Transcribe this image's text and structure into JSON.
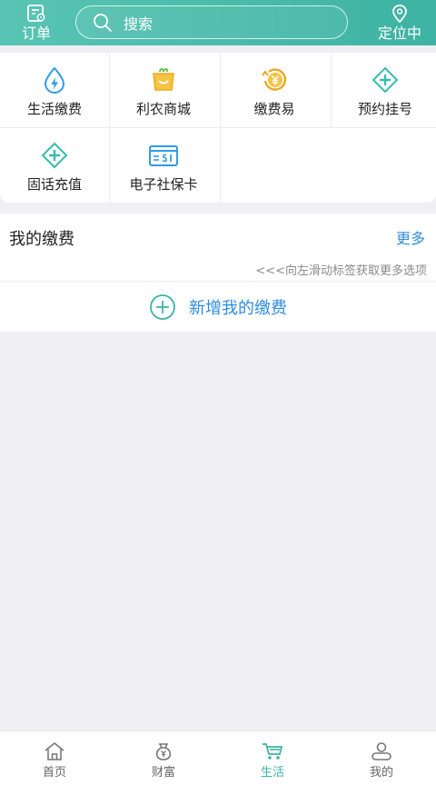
{
  "header": {
    "orders_label": "订单",
    "search_placeholder": "搜索",
    "location_label": "定位中"
  },
  "services": [
    {
      "label": "生活缴费",
      "icon": "water-bolt-icon",
      "color": "#2f9be8"
    },
    {
      "label": "利农商城",
      "icon": "shopping-basket-icon",
      "color": "#f0a81e"
    },
    {
      "label": "缴费易",
      "icon": "yen-coin-icon",
      "color": "#f0a81e"
    },
    {
      "label": "预约挂号",
      "icon": "medical-cross-icon",
      "color": "#35bcb0"
    },
    {
      "label": "固话充值",
      "icon": "medical-cross-icon",
      "color": "#35bcb0"
    },
    {
      "label": "电子社保卡",
      "icon": "social-security-card-icon",
      "color": "#2f9be8"
    }
  ],
  "my_payments": {
    "title": "我的缴费",
    "more_label": "更多",
    "hint": "<<<向左滑动标签获取更多选项",
    "add_label": "新增我的缴费"
  },
  "tabs": [
    {
      "label": "首页",
      "icon": "home-icon",
      "active": false
    },
    {
      "label": "财富",
      "icon": "money-bag-icon",
      "active": false
    },
    {
      "label": "生活",
      "icon": "shopping-cart-icon",
      "active": true
    },
    {
      "label": "我的",
      "icon": "user-icon",
      "active": false
    }
  ],
  "colors": {
    "header": "#46b8a8",
    "accent": "#3eb3a3",
    "link": "#2f8ddc"
  }
}
